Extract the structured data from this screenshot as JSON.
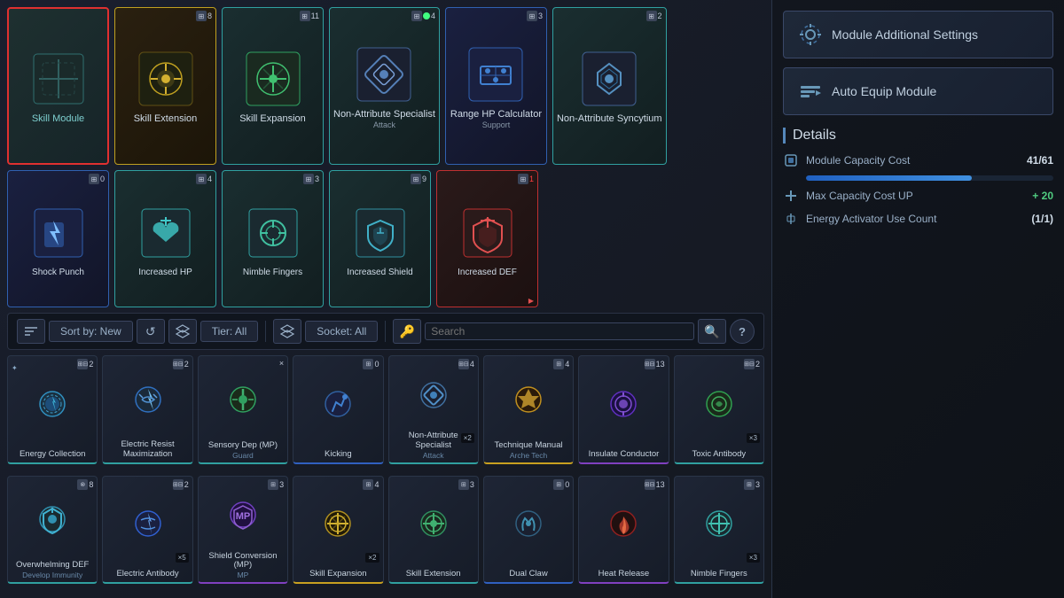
{
  "equipped": {
    "slot_label": "Skill Module",
    "top_row": [
      {
        "id": "skill-extension",
        "name": "Skill Extension",
        "sub": "",
        "count": "8",
        "tier": "yellow"
      },
      {
        "id": "skill-expansion",
        "name": "Skill Expansion",
        "sub": "",
        "count": "11",
        "tier": "teal"
      },
      {
        "id": "non-attr-specialist",
        "name": "Non-Attribute Specialist",
        "sub": "Attack",
        "count": "4",
        "tier": "teal",
        "green": true
      },
      {
        "id": "range-hp-calculator",
        "name": "Range HP Calculator",
        "sub": "Support",
        "count": "3",
        "tier": "blue"
      },
      {
        "id": "non-attr-syncytium",
        "name": "Non-Attribute Syncytium",
        "sub": "",
        "count": "2",
        "tier": "teal"
      }
    ],
    "mid_row": [
      {
        "id": "shock-punch",
        "name": "Shock Punch",
        "sub": "",
        "count": "0",
        "tier": "blue"
      },
      {
        "id": "increased-hp",
        "name": "Increased HP",
        "sub": "",
        "count": "4",
        "tier": "teal"
      },
      {
        "id": "nimble-fingers",
        "name": "Nimble Fingers",
        "sub": "",
        "count": "3",
        "tier": "teal"
      },
      {
        "id": "increased-shield",
        "name": "Increased Shield",
        "sub": "",
        "count": "9",
        "tier": "teal"
      },
      {
        "id": "increased-def",
        "name": "Increased DEF",
        "sub": "",
        "count": "1",
        "tier": "red"
      }
    ]
  },
  "filter_bar": {
    "sort_label": "Sort by: New",
    "tier_label": "Tier: All",
    "socket_label": "Socket: All",
    "search_placeholder": "Search"
  },
  "details": {
    "title": "Details",
    "module_capacity_label": "Module Capacity Cost",
    "module_capacity_value": "41/61",
    "capacity_percent": 67,
    "max_capacity_label": "Max Capacity Cost UP",
    "max_capacity_value": "+ 20",
    "energy_label": "Energy Activator Use Count",
    "energy_value": "(1/1)"
  },
  "right_buttons": [
    {
      "id": "module-settings",
      "label": "Module Additional Settings",
      "icon": "⚙"
    },
    {
      "id": "auto-equip",
      "label": "Auto Equip Module",
      "icon": "📊"
    }
  ],
  "inventory": [
    {
      "id": "energy-collection",
      "name": "Energy Collection",
      "sub": "",
      "count": "2",
      "tier": "teal",
      "icon": "energy"
    },
    {
      "id": "electric-resist",
      "name": "Electric Resist Maximization",
      "sub": "",
      "count": "2",
      "tier": "teal",
      "icon": "elec-resist"
    },
    {
      "id": "sensory-dep",
      "name": "Sensory Dep (MP)",
      "sub": "Guard",
      "count": "×",
      "tier": "teal",
      "icon": "sensory"
    },
    {
      "id": "kicking",
      "name": "Kicking",
      "sub": "",
      "count": "0",
      "tier": "blue",
      "icon": "kicking"
    },
    {
      "id": "non-attr-spec2",
      "name": "Non-Attribute Specialist",
      "sub": "Attack",
      "count": "4",
      "tier": "teal",
      "icon": "non-attr",
      "multi": "×2"
    },
    {
      "id": "technique-manual",
      "name": "Technique Manual",
      "sub": "Arche Tech",
      "count": "4",
      "tier": "gold",
      "icon": "technique"
    },
    {
      "id": "insulate-conductor",
      "name": "Insulate Conductor",
      "sub": "",
      "count": "13",
      "tier": "purple",
      "icon": "insulate"
    },
    {
      "id": "toxic-antibody",
      "name": "Toxic Antibody",
      "sub": "",
      "count": "2",
      "tier": "teal",
      "icon": "toxic",
      "multi": "×3"
    },
    {
      "id": "overwhelming-def",
      "name": "Overwhelming DEF",
      "sub": "Develop Immunity",
      "count": "8",
      "tier": "teal",
      "icon": "overwhelming"
    },
    {
      "id": "electric-antibody",
      "name": "Electric Antibody",
      "sub": "",
      "count": "2",
      "tier": "teal",
      "icon": "elec-anti",
      "multi": "×5"
    },
    {
      "id": "shield-conversion",
      "name": "Shield Conversion (MP)",
      "sub": "MP",
      "count": "3",
      "tier": "purple",
      "icon": "shield-conv"
    },
    {
      "id": "skill-expansion2",
      "name": "Skill Expansion",
      "sub": "",
      "count": "4",
      "tier": "yellow",
      "icon": "skill-exp",
      "multi": "×2"
    },
    {
      "id": "skill-extension2",
      "name": "Skill Extension",
      "sub": "",
      "count": "3",
      "tier": "teal",
      "icon": "skill-ext"
    },
    {
      "id": "dual-claw",
      "name": "Dual Claw",
      "sub": "",
      "count": "0",
      "tier": "blue",
      "icon": "dual-claw"
    },
    {
      "id": "heat-release",
      "name": "Heat Release",
      "sub": "",
      "count": "13",
      "tier": "purple",
      "icon": "heat-release"
    },
    {
      "id": "nimble-fingers2",
      "name": "Nimble Fingers",
      "sub": "",
      "count": "3",
      "tier": "teal",
      "icon": "nimble",
      "multi": "×3"
    }
  ]
}
